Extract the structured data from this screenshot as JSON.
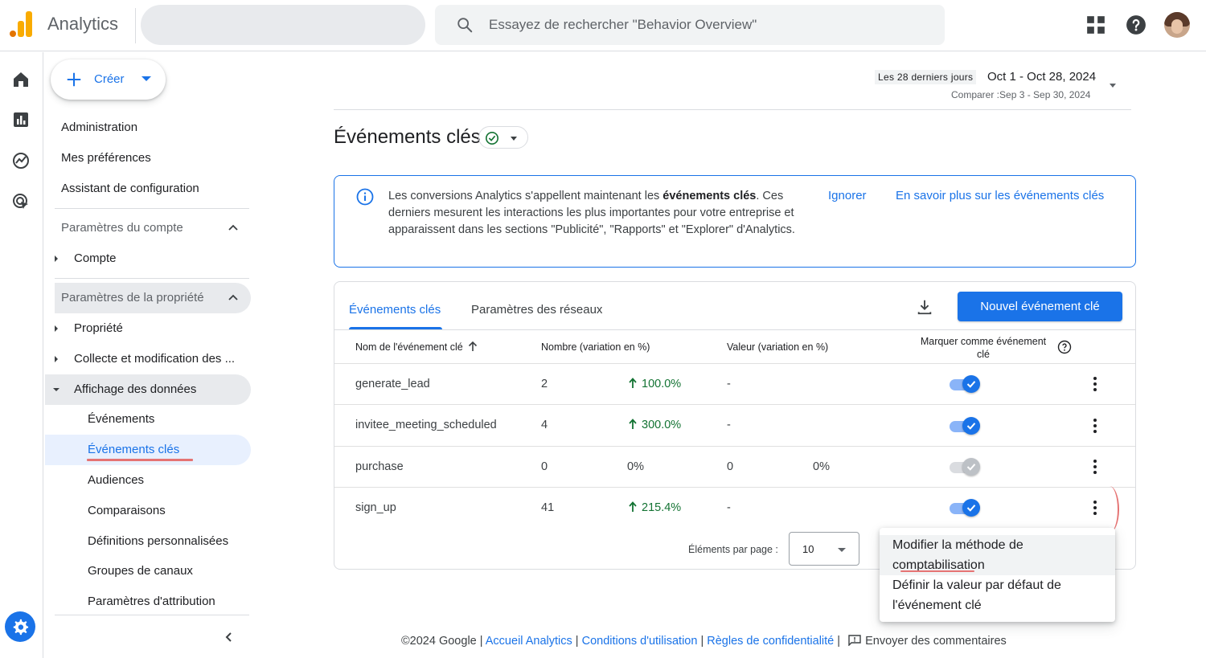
{
  "app": {
    "title": "Analytics"
  },
  "search": {
    "placeholder": "Essayez de rechercher \"Behavior Overview\""
  },
  "sidebar": {
    "create_label": "Créer",
    "top_items": [
      "Administration",
      "Mes préférences",
      "Assistant de configuration"
    ],
    "account_section": {
      "title": "Paramètres du compte",
      "items": [
        "Compte"
      ]
    },
    "property_section": {
      "title": "Paramètres de la propriété",
      "items": [
        "Propriété",
        "Collecte et modification des ...",
        "Affichage des données"
      ],
      "sub_items": [
        "Événements",
        "Événements clés",
        "Audiences",
        "Comparaisons",
        "Définitions personnalisées",
        "Groupes de canaux",
        "Paramètres d'attribution"
      ]
    }
  },
  "date_range": {
    "preset": "Les 28 derniers jours",
    "range": "Oct 1 - Oct 28, 2024",
    "compare": "Comparer :Sep 3 - Sep 30, 2024"
  },
  "page": {
    "title": "Événements clés"
  },
  "banner": {
    "text_before": "Les conversions Analytics s'appellent maintenant les ",
    "text_bold": "événements clés",
    "text_after": ". Ces derniers mesurent les interactions les plus importantes pour votre entreprise et apparaissent dans les sections \"Publicité\", \"Rapports\" et \"Explorer\" d'Analytics.",
    "dismiss": "Ignorer",
    "learn_more": "En savoir plus sur les événements clés"
  },
  "tabs": [
    "Événements clés",
    "Paramètres des réseaux"
  ],
  "new_button": "Nouvel événement clé",
  "table": {
    "headers": {
      "name": "Nom de l'événement clé",
      "count": "Nombre (variation en %)",
      "value": "Valeur (variation en %)",
      "mark_line1": "Marquer comme événement",
      "mark_line2": "clé"
    },
    "rows": [
      {
        "name": "generate_lead",
        "count": "2",
        "count_change": "100.0%",
        "count_up": true,
        "value": "-",
        "value_change": "",
        "key_event": true
      },
      {
        "name": "invitee_meeting_scheduled",
        "count": "4",
        "count_change": "300.0%",
        "count_up": true,
        "value": "-",
        "value_change": "",
        "key_event": true
      },
      {
        "name": "purchase",
        "count": "0",
        "count_change": "0%",
        "count_up": false,
        "value": "0",
        "value_change": "0%",
        "key_event": false
      },
      {
        "name": "sign_up",
        "count": "41",
        "count_change": "215.4%",
        "count_up": true,
        "value": "-",
        "value_change": "",
        "key_event": true
      }
    ]
  },
  "pagination": {
    "label": "Éléments par page :",
    "value": "10"
  },
  "context_menu": {
    "item1_line1": "Modifier la méthode de",
    "item1_line2": "comptabilisation",
    "item2_line1": "Définir la valeur par défaut de",
    "item2_line2": "l'événement clé"
  },
  "footer": {
    "copyright": "©2024 Google",
    "home": "Accueil Analytics",
    "terms": "Conditions d'utilisation",
    "privacy": "Règles de confidentialité",
    "feedback": "Envoyer des commentaires"
  },
  "colors": {
    "accent": "#1a73e8",
    "positive": "#137333",
    "logo": "#f9ab00",
    "annotation": "#e57373"
  }
}
